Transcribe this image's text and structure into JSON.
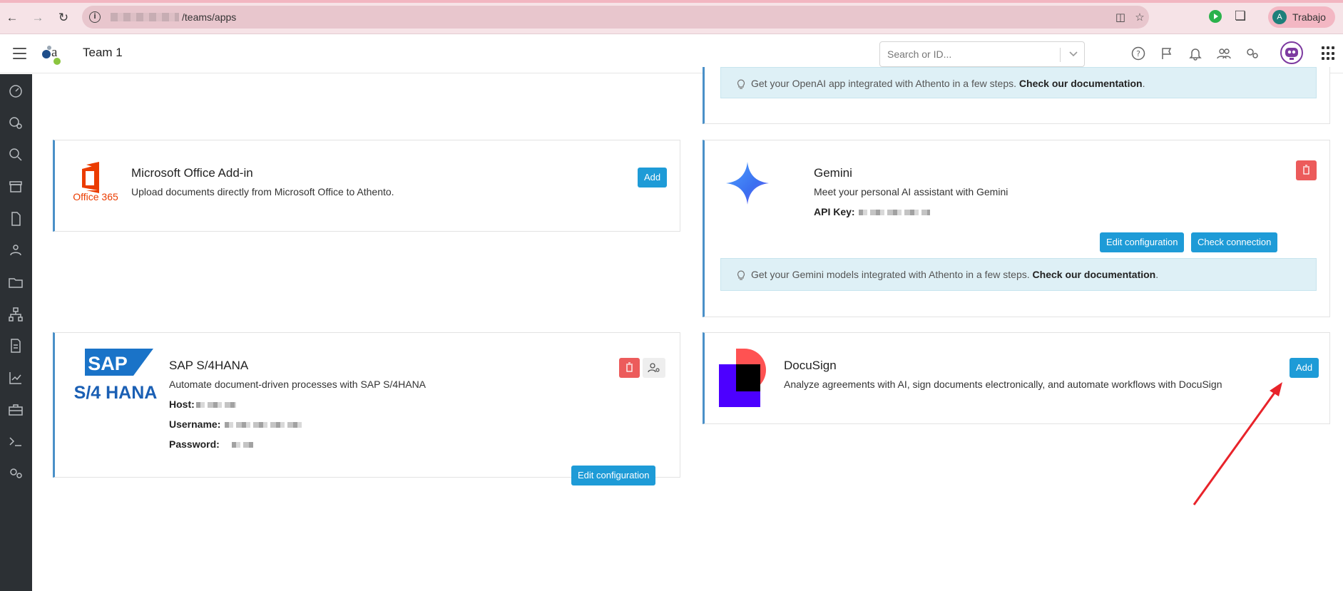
{
  "browser": {
    "url_path": "/teams/apps",
    "profile_initial": "A",
    "profile_name": "Trabajo"
  },
  "header": {
    "team_title": "Team 1",
    "search_placeholder": "Search or ID..."
  },
  "apps": {
    "openai_banner": {
      "text": "Get your OpenAI app integrated with Athento in a few steps.",
      "link": "Check our documentation",
      "suffix": "."
    },
    "office": {
      "logo_text": "Office 365",
      "title": "Microsoft Office Add-in",
      "description": "Upload documents directly from Microsoft Office to Athento.",
      "add_label": "Add"
    },
    "gemini": {
      "title": "Gemini",
      "description": "Meet your personal AI assistant with Gemini",
      "api_key_label": "API Key:",
      "edit_label": "Edit configuration",
      "check_label": "Check connection",
      "banner_text": "Get your Gemini models integrated with Athento in a few steps.",
      "banner_link": "Check our documentation",
      "banner_suffix": "."
    },
    "sap": {
      "logo_top": "SAP",
      "logo_bottom": "S/4 HANA",
      "title": "SAP S/4HANA",
      "description": "Automate document-driven processes with SAP S/4HANA",
      "host_label": "Host:",
      "username_label": "Username:",
      "password_label": "Password:",
      "edit_label": "Edit configuration"
    },
    "docusign": {
      "title": "DocuSign",
      "description": "Analyze agreements with AI, sign documents electronically, and automate workflows with DocuSign",
      "add_label": "Add"
    }
  },
  "colors": {
    "primary": "#1e9bd7",
    "danger": "#ec5b5b",
    "card_accent": "#4a90c8",
    "rail": "#2c3034",
    "banner_bg": "#def0f6",
    "annotation_arrow": "#e8232a"
  }
}
